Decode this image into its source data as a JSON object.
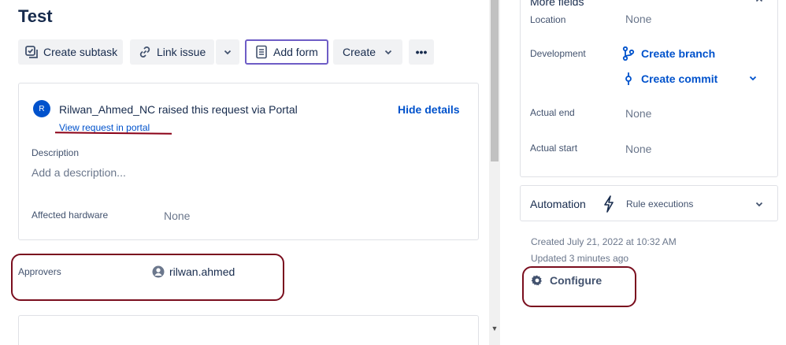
{
  "issue": {
    "title": "Test"
  },
  "toolbar": {
    "create_subtask": "Create subtask",
    "link_issue": "Link issue",
    "add_form": "Add form",
    "create": "Create",
    "more": "•••"
  },
  "request": {
    "avatar_initial": "R",
    "reporter": "Rilwan_Ahmed_NC",
    "raised_text": " raised this request via ",
    "channel": "Portal",
    "view_portal": "View request in portal",
    "hide_details": "Hide details"
  },
  "description": {
    "label": "Description",
    "placeholder": "Add a description..."
  },
  "affected_hardware": {
    "label": "Affected hardware",
    "value": "None"
  },
  "approvers": {
    "label": "Approvers",
    "value": "rilwan.ahmed"
  },
  "more_fields": {
    "title": "More fields",
    "location": {
      "label": "Location",
      "value": "None"
    },
    "development": {
      "label": "Development",
      "create_branch": "Create branch",
      "create_commit": "Create commit"
    },
    "actual_end": {
      "label": "Actual end",
      "value": "None"
    },
    "actual_start": {
      "label": "Actual start",
      "value": "None"
    }
  },
  "automation": {
    "title": "Automation",
    "rule_executions": "Rule executions"
  },
  "meta": {
    "created": "Created July 21, 2022 at 10:32 AM",
    "updated": "Updated 3 minutes ago"
  },
  "configure": "Configure",
  "colors": {
    "link": "#0052cc",
    "annotation": "#7a0e1e",
    "add_form_border": "#6e5dc6"
  }
}
